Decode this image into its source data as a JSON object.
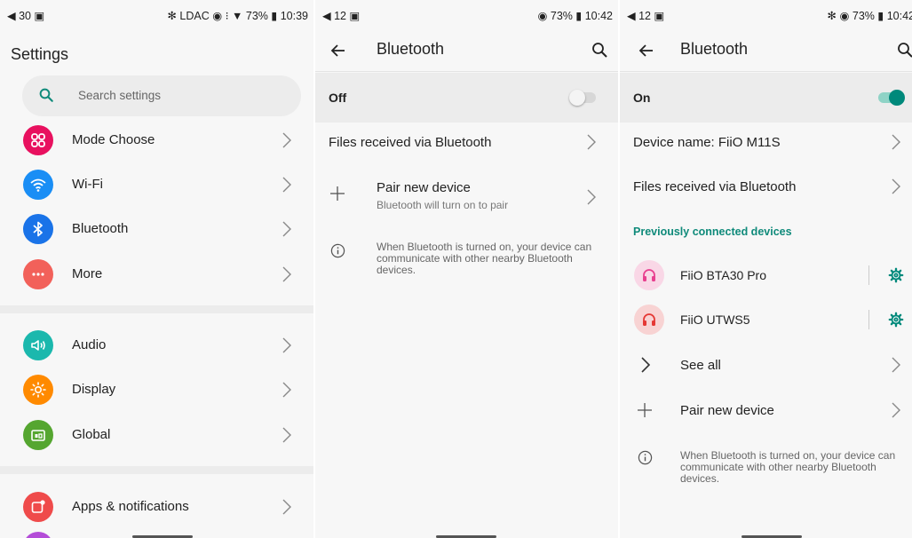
{
  "panel1": {
    "status_left": "◀ 30 ▣",
    "status_right": "✻ LDAC ◉ ⁝ ▼ 73% ▮ 10:39",
    "title": "Settings",
    "search_placeholder": "Search settings",
    "items": [
      {
        "label": "Mode Choose",
        "icon": "mode-choose-icon",
        "color": "#e8115f"
      },
      {
        "label": "Wi-Fi",
        "icon": "wifi-icon",
        "color": "#1a8ef5"
      },
      {
        "label": "Bluetooth",
        "icon": "bluetooth-icon",
        "color": "#1a73e8"
      },
      {
        "label": "More",
        "icon": "more-icon",
        "color": "#f2615a"
      },
      {
        "label": "Audio",
        "icon": "audio-icon",
        "color": "#1bb8ad"
      },
      {
        "label": "Display",
        "icon": "display-icon",
        "color": "#ff8a00"
      },
      {
        "label": "Global",
        "icon": "global-icon",
        "color": "#55a630"
      },
      {
        "label": "Apps & notifications",
        "icon": "apps-notifications-icon",
        "color": "#ef4b4b"
      }
    ]
  },
  "panel2": {
    "status_left": "◀ 12 ▣",
    "status_right": "◉ 73% ▮ 10:42",
    "title": "Bluetooth",
    "toggle_label": "Off",
    "toggle_on": false,
    "files_label": "Files received via Bluetooth",
    "pair_label": "Pair new device",
    "pair_sub": "Bluetooth will turn on to pair",
    "info_text": "When Bluetooth is turned on, your device can communicate with other nearby Bluetooth devices."
  },
  "panel3": {
    "status_left": "◀ 12 ▣",
    "status_right": "✻ ◉ 73% ▮ 10:42",
    "title": "Bluetooth",
    "toggle_label": "On",
    "toggle_on": true,
    "device_name_label": "Device name: FiiO M11S",
    "files_label": "Files received via Bluetooth",
    "prev_header": "Previously connected devices",
    "devices": [
      {
        "name": "FiiO BTA30 Pro",
        "color": "#e8408f"
      },
      {
        "name": "FiiO UTWS5",
        "color": "#e53935"
      }
    ],
    "see_all_label": "See all",
    "pair_label": "Pair new device",
    "info_text": "When Bluetooth is turned on, your device can communicate with other nearby Bluetooth devices."
  },
  "colors": {
    "accent": "#0f8a7a",
    "switch_on_track": "#8fd3c6",
    "switch_on_thumb": "#00897b",
    "switch_off_track": "#d7d7d7",
    "switch_off_thumb": "#f4f4f4"
  }
}
